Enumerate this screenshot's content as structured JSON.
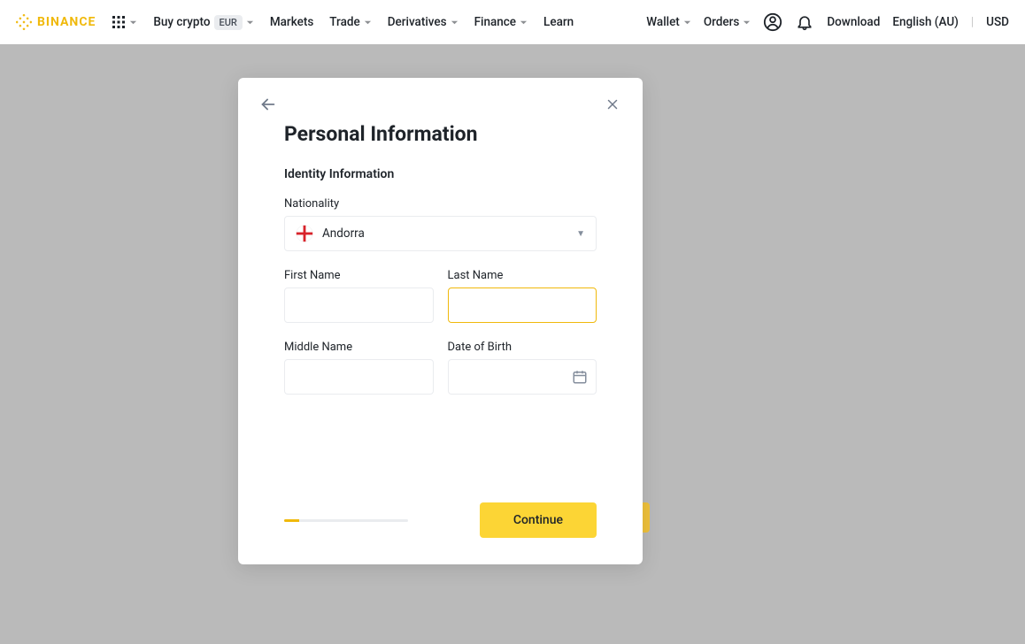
{
  "brand": {
    "name": "BINANCE",
    "accent": "#f0b90b"
  },
  "nav": {
    "buy_crypto": "Buy crypto",
    "buy_currency_badge": "EUR",
    "markets": "Markets",
    "trade": "Trade",
    "derivatives": "Derivatives",
    "finance": "Finance",
    "learn": "Learn",
    "wallet": "Wallet",
    "orders": "Orders",
    "download": "Download",
    "language": "English (AU)",
    "currency": "USD"
  },
  "modal": {
    "title": "Personal Information",
    "section": "Identity Information",
    "continue": "Continue",
    "fields": {
      "nationality_label": "Nationality",
      "nationality_value": "Andorra",
      "first_name_label": "First Name",
      "first_name_value": "",
      "last_name_label": "Last Name",
      "last_name_value": "",
      "middle_name_label": "Middle Name",
      "middle_name_value": "",
      "dob_label": "Date of Birth",
      "dob_value": ""
    }
  }
}
